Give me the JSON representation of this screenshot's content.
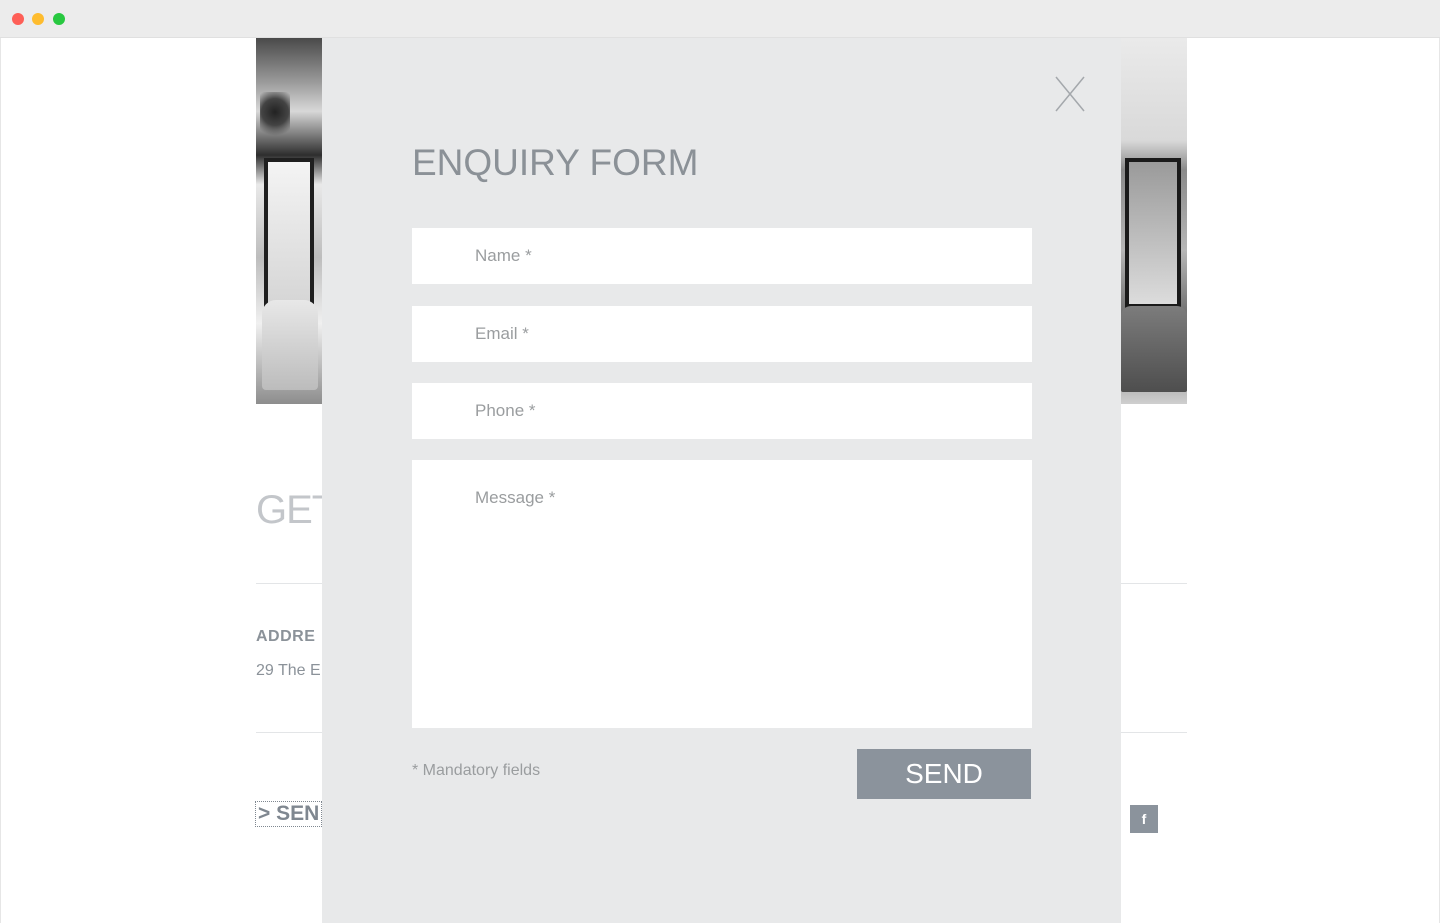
{
  "background": {
    "heading": "GET",
    "address_label": "ADDRE",
    "address_text": "29 The E",
    "send_link": "> SEN",
    "facebook_icon": "f"
  },
  "modal": {
    "title": "ENQUIRY FORM",
    "close_icon": "close-icon",
    "fields": {
      "name_placeholder": "Name *",
      "email_placeholder": "Email *",
      "phone_placeholder": "Phone *",
      "message_placeholder": "Message *"
    },
    "mandatory_note": "* Mandatory fields",
    "send_label": "SEND"
  },
  "colors": {
    "modal_bg": "#e8e9ea",
    "button_bg": "#8b939c",
    "title": "#8b9197"
  }
}
